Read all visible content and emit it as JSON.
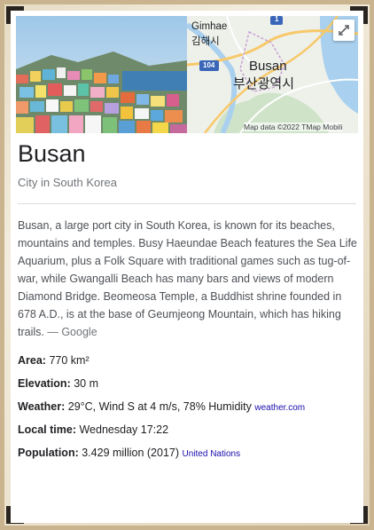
{
  "place": {
    "name": "Busan",
    "type": "City in South Korea",
    "description": "Busan, a large port city in South Korea, is known for its beaches, mountains and temples. Busy Haeundae Beach features the Sea Life Aquarium, plus a Folk Square with traditional games such as tug-of-war, while Gwangalli Beach has many bars and views of modern Diamond Bridge. Beomeosa Temple, a Buddhist shrine founded in 678 A.D., is at the base of Geumjeong Mountain, which has hiking trails.",
    "description_source": "— Google"
  },
  "map": {
    "label_gimhae_en": "Gimhae",
    "label_gimhae_ko": "김해시",
    "label_busan_en": "Busan",
    "label_busan_ko": "부산광역시",
    "road_badge": "104",
    "road_badge2": "1",
    "attribution": "Map data ©2022 TMap Mobili"
  },
  "facts": [
    {
      "label": "Area:",
      "value": "770 km²",
      "link": ""
    },
    {
      "label": "Elevation:",
      "value": "30 m",
      "link": ""
    },
    {
      "label": "Weather:",
      "value": "29°C, Wind S at 4 m/s, 78% Humidity",
      "link": "weather.com"
    },
    {
      "label": "Local time:",
      "value": "Wednesday 17:22",
      "link": ""
    },
    {
      "label": "Population:",
      "value": "3.429 million (2017)",
      "link": "United Nations"
    }
  ],
  "icons": {
    "expand": "expand-icon"
  }
}
